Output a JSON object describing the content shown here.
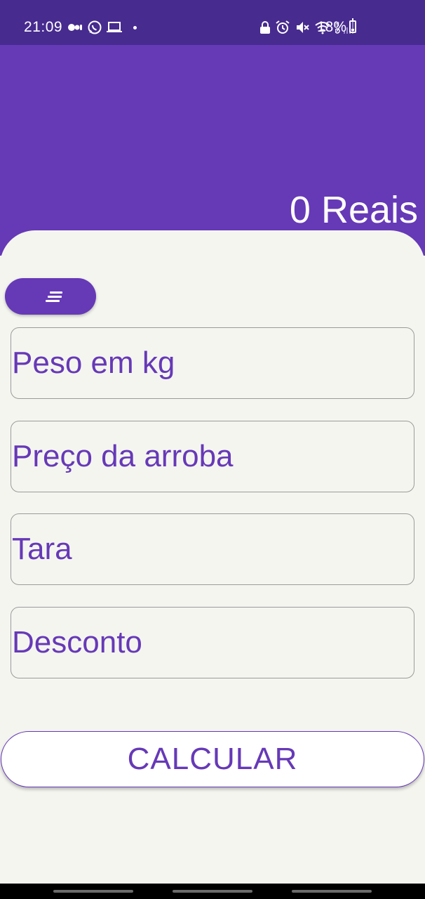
{
  "status_bar": {
    "time": "21:09",
    "battery": "18%",
    "left_icons": [
      "media-icon",
      "whatsapp-icon",
      "laptop-icon",
      "dot-icon"
    ],
    "right_icons": [
      "lock-icon",
      "alarm-icon",
      "mute-icon",
      "wifi-icon",
      "signal-icon",
      "battery-icon"
    ]
  },
  "header": {
    "result": "0 Reais"
  },
  "form": {
    "fields": [
      {
        "placeholder": "Peso em kg",
        "value": ""
      },
      {
        "placeholder": "Preço da arroba",
        "value": ""
      },
      {
        "placeholder": "Tara",
        "value": ""
      },
      {
        "placeholder": "Desconto",
        "value": ""
      }
    ],
    "calculate_label": "CALCULAR"
  },
  "colors": {
    "status_bar": "#472b8f",
    "primary": "#6639b7",
    "background": "#f5f5f0",
    "field_border": "#9a9a9a"
  }
}
